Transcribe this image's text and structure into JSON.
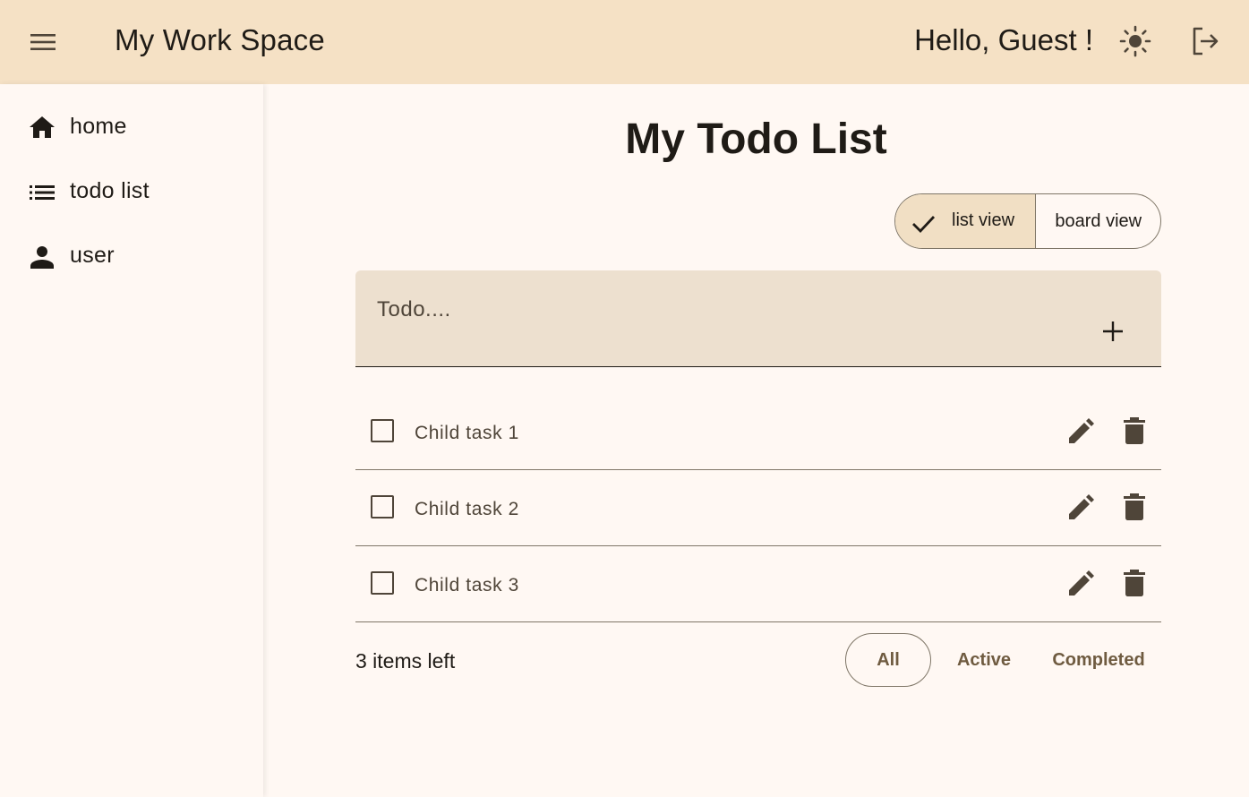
{
  "header": {
    "app_title": "My Work Space",
    "greeting": "Hello, Guest !",
    "menu_icon": "menu-icon",
    "theme_icon": "sun-icon",
    "logout_icon": "logout-icon",
    "background_color": "#f5e1c5"
  },
  "sidebar": {
    "items": [
      {
        "label": "home",
        "icon": "home-icon"
      },
      {
        "label": "todo list",
        "icon": "list-icon"
      },
      {
        "label": "user",
        "icon": "person-icon"
      }
    ]
  },
  "main": {
    "title": "My Todo List",
    "view_toggle": {
      "list_view_label": "list view",
      "board_view_label": "board view",
      "selected": "list view"
    },
    "todo_input": {
      "placeholder": "Todo....",
      "value": ""
    },
    "tasks": [
      {
        "title": "Child task 1",
        "completed": false
      },
      {
        "title": "Child task 2",
        "completed": false
      },
      {
        "title": "Child task 3",
        "completed": false
      }
    ],
    "footer": {
      "items_left": "3 items left",
      "filters": {
        "all": "All",
        "active": "Active",
        "completed": "Completed",
        "selected": "All"
      }
    }
  }
}
